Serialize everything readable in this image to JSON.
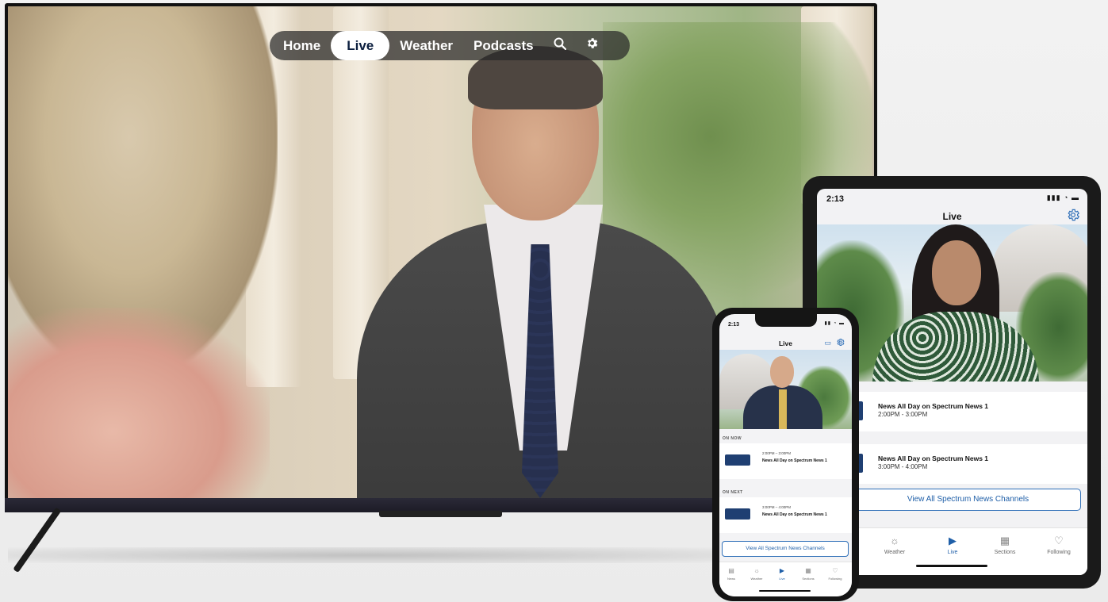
{
  "tv": {
    "nav": {
      "home": "Home",
      "live": "Live",
      "weather": "Weather",
      "podcasts": "Podcasts",
      "search_icon": "search-icon",
      "settings_icon": "gear-icon"
    }
  },
  "tablet": {
    "status_time": "2:13",
    "title": "Live",
    "schedule": [
      {
        "title": "News All Day on Spectrum News 1",
        "time": "2:00PM - 3:00PM"
      },
      {
        "title": "News All Day on Spectrum News 1",
        "time": "3:00PM - 4:00PM"
      }
    ],
    "view_all": "View All Spectrum News Channels",
    "tabs": [
      {
        "label": "Weather",
        "icon": "sun-icon"
      },
      {
        "label": "Live",
        "icon": "play-icon"
      },
      {
        "label": "Sections",
        "icon": "grid-icon"
      },
      {
        "label": "Following",
        "icon": "heart-icon"
      }
    ]
  },
  "phone": {
    "status_time": "2:13",
    "title": "Live",
    "on_now_label": "ON NOW",
    "on_next_label": "ON NEXT",
    "on_now": {
      "time": "2:00PM – 3:00PM",
      "title": "News All Day on Spectrum News 1"
    },
    "on_next": {
      "time": "3:00PM – 4:00PM",
      "title": "News All Day on Spectrum News 1"
    },
    "view_all": "View All Spectrum News Channels",
    "tabs": [
      {
        "label": "News",
        "icon": "news-icon"
      },
      {
        "label": "Weather",
        "icon": "sun-icon"
      },
      {
        "label": "Live",
        "icon": "play-icon"
      },
      {
        "label": "Sections",
        "icon": "grid-icon"
      },
      {
        "label": "Following",
        "icon": "heart-icon"
      }
    ]
  },
  "colors": {
    "accent": "#1f5fa8",
    "nav_active_text": "#0b1e3e"
  }
}
